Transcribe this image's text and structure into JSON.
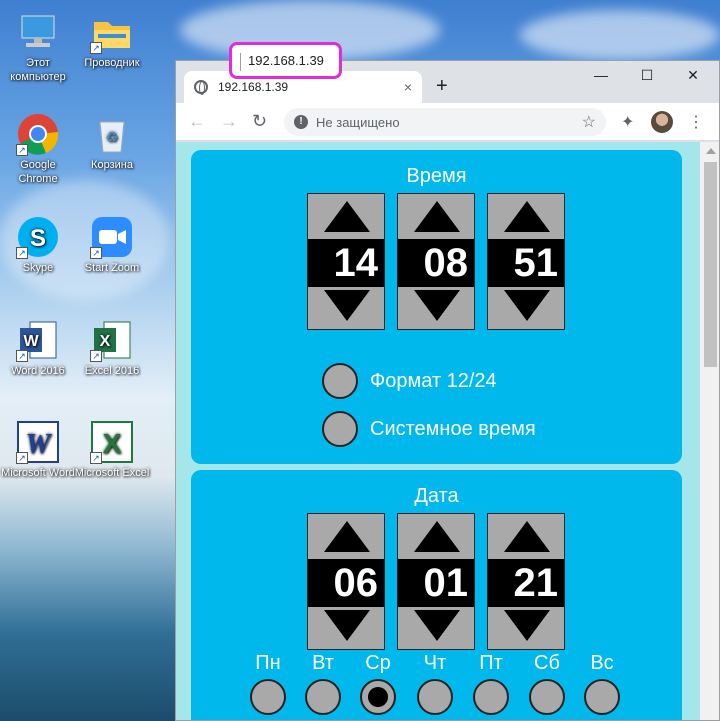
{
  "desktop": {
    "icons": [
      {
        "label": "Этот компьютер",
        "icon": "computer-icon"
      },
      {
        "label": "Проводник",
        "icon": "folder-icon"
      },
      {
        "label": "Google Chrome",
        "icon": "chrome-icon"
      },
      {
        "label": "Корзина",
        "icon": "recycle-bin-icon"
      },
      {
        "label": "Skype",
        "icon": "skype-icon"
      },
      {
        "label": "Start Zoom",
        "icon": "zoom-icon"
      },
      {
        "label": "Word 2016",
        "icon": "word-icon"
      },
      {
        "label": "Excel 2016",
        "icon": "excel-icon"
      },
      {
        "label": "Microsoft Word",
        "icon": "word-legacy-icon"
      },
      {
        "label": "Microsoft Excel",
        "icon": "excel-legacy-icon"
      }
    ]
  },
  "browser": {
    "tab_title": "192.168.1.39",
    "tab_close": "×",
    "new_tab": "+",
    "minimize": "—",
    "maximize": "☐",
    "close": "✕",
    "security_label": "Не защищено",
    "url": "192.168.1.39",
    "back": "←",
    "forward": "→",
    "reload": "↻",
    "bookmark": "☆",
    "extensions": "✦",
    "menu": "⋮",
    "highlight_color": "#e22bd9"
  },
  "page": {
    "time": {
      "title": "Время",
      "hours": "14",
      "minutes": "08",
      "seconds": "51",
      "option_format": "Формат 12/24",
      "option_system": "Системное время"
    },
    "date": {
      "title": "Дата",
      "day": "06",
      "month": "01",
      "year": "21",
      "weekdays": [
        "Пн",
        "Вт",
        "Ср",
        "Чт",
        "Пт",
        "Сб",
        "Вс"
      ],
      "selected_weekday": "Ср"
    },
    "colors": {
      "panel": "#00b8ec",
      "background": "#a4e6ea",
      "control": "#a9a9a9"
    }
  }
}
